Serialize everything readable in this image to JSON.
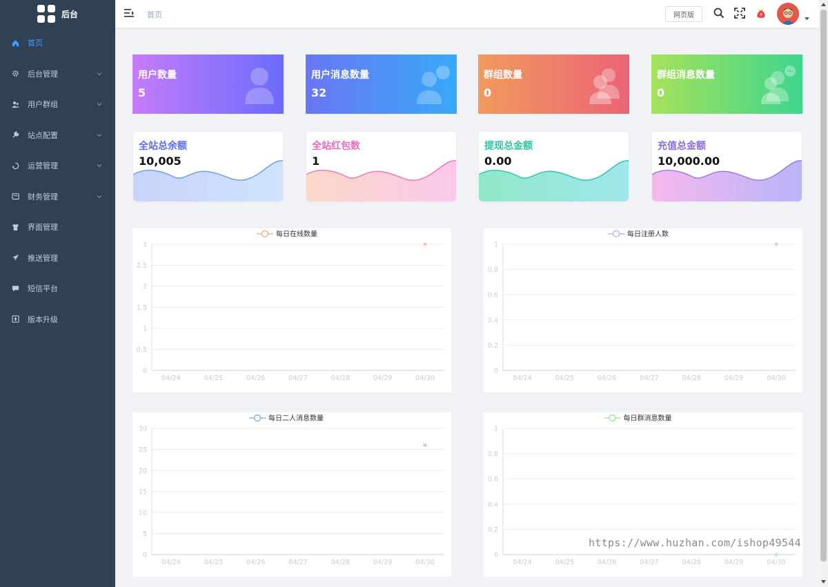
{
  "sidebar": {
    "logo_text": "后台",
    "items": [
      {
        "label": "首页",
        "icon": "home-icon",
        "active": true,
        "has_arrow": false
      },
      {
        "label": "后台管理",
        "icon": "gear-icon",
        "active": false,
        "has_arrow": true
      },
      {
        "label": "用户群组",
        "icon": "users-icon",
        "active": false,
        "has_arrow": true
      },
      {
        "label": "站点配置",
        "icon": "wrench-icon",
        "active": false,
        "has_arrow": true
      },
      {
        "label": "运营管理",
        "icon": "cycle-icon",
        "active": false,
        "has_arrow": true
      },
      {
        "label": "财务管理",
        "icon": "wallet-icon",
        "active": false,
        "has_arrow": true
      },
      {
        "label": "界面管理",
        "icon": "shirt-icon",
        "active": false,
        "has_arrow": false
      },
      {
        "label": "推送管理",
        "icon": "send-icon",
        "active": false,
        "has_arrow": false
      },
      {
        "label": "短信平台",
        "icon": "message-icon",
        "active": false,
        "has_arrow": false
      },
      {
        "label": "版本升级",
        "icon": "upgrade-icon",
        "active": false,
        "has_arrow": false
      }
    ]
  },
  "header": {
    "breadcrumb": "首页",
    "web_button": "网页版"
  },
  "stats": [
    {
      "label": "用户数量",
      "value": "5",
      "from": "#c57bfb",
      "to": "#6a6cfb",
      "icon": "user-icon"
    },
    {
      "label": "用户消息数量",
      "value": "32",
      "from": "#6a76f3",
      "to": "#38a9f8",
      "icon": "user-message-icon"
    },
    {
      "label": "群组数量",
      "value": "0",
      "from": "#f19a5c",
      "to": "#eb6476",
      "icon": "group-icon"
    },
    {
      "label": "群组消息数量",
      "value": "0",
      "from": "#a6e25a",
      "to": "#3ed58f",
      "icon": "group-message-icon"
    }
  ],
  "balances": [
    {
      "label": "全站总余额",
      "value": "10,005",
      "label_color": "#5c6ef0",
      "line": "#6b9ef0",
      "fill_from": "#c8d4fb",
      "fill_to": "#cfe3fb"
    },
    {
      "label": "全站红包数",
      "value": "1",
      "label_color": "#f069c0",
      "line": "#f07ab0",
      "fill_from": "#fbd8c8",
      "fill_to": "#fbc8ec"
    },
    {
      "label": "提现总金额",
      "value": "0.00",
      "label_color": "#2ec6a6",
      "line": "#2ec6b0",
      "fill_from": "#90e8c8",
      "fill_to": "#a0e6ec"
    },
    {
      "label": "充值总金额",
      "value": "10,000.00",
      "label_color": "#8a6de0",
      "line": "#9a7ae8",
      "fill_from": "#f6b8ee",
      "fill_to": "#b8b4f8"
    }
  ],
  "chart_data": [
    {
      "type": "line",
      "title": "每日在线数量",
      "color": "#f0a080",
      "x": [
        "04/24",
        "04/25",
        "04/26",
        "04/27",
        "04/28",
        "04/29",
        "04/30"
      ],
      "y_ticks": [
        "0",
        "0.5",
        "1",
        "1.5",
        "2",
        "2.5",
        "3"
      ],
      "ylim": [
        0,
        3
      ],
      "series": [
        {
          "name": "每日在线数量",
          "values": [
            null,
            null,
            null,
            null,
            null,
            null,
            3
          ]
        }
      ]
    },
    {
      "type": "line",
      "title": "每日注册人数",
      "color": "#b0a8f0",
      "x": [
        "04/24",
        "04/25",
        "04/26",
        "04/27",
        "04/28",
        "04/29",
        "04/30"
      ],
      "y_ticks": [
        "0",
        "0.2",
        "0.4",
        "0.6",
        "0.8",
        "1"
      ],
      "ylim": [
        0,
        1
      ],
      "series": [
        {
          "name": "每日注册人数",
          "values": [
            null,
            null,
            null,
            null,
            null,
            null,
            1
          ]
        }
      ]
    },
    {
      "type": "line",
      "title": "每日二人消息数量",
      "color": "#70a8e8",
      "x": [
        "04/24",
        "04/25",
        "04/26",
        "04/27",
        "04/28",
        "04/29",
        "04/30"
      ],
      "y_ticks": [
        "0",
        "5",
        "10",
        "15",
        "20",
        "25",
        "30"
      ],
      "ylim": [
        0,
        30
      ],
      "series": [
        {
          "name": "每日二人消息数量",
          "values": [
            null,
            null,
            null,
            null,
            null,
            null,
            26
          ]
        }
      ]
    },
    {
      "type": "line",
      "title": "每日群消息数量",
      "color": "#90e890",
      "x": [
        "04/24",
        "04/25",
        "04/26",
        "04/27",
        "04/28",
        "04/29",
        "04/30"
      ],
      "y_ticks": [
        "0",
        "0.2",
        "0.4",
        "0.6",
        "0.8",
        "1"
      ],
      "ylim": [
        0,
        1
      ],
      "series": [
        {
          "name": "每日群消息数量",
          "values": [
            null,
            null,
            null,
            null,
            null,
            null,
            0
          ]
        }
      ]
    }
  ],
  "watermark": "https://www.huzhan.com/ishop49544"
}
